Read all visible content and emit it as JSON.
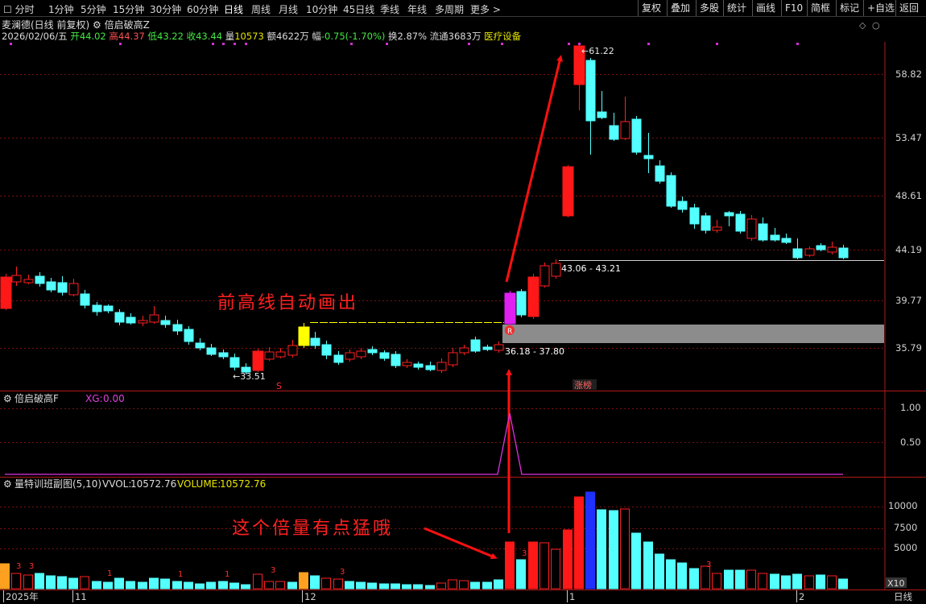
{
  "toolbar": {
    "periods": [
      "分时",
      "1分钟",
      "5分钟",
      "15分钟",
      "30分钟",
      "60分钟",
      "日线",
      "周线",
      "月线",
      "10分钟",
      "45日线",
      "季线",
      "年线",
      "多周期",
      "更多"
    ],
    "more_arrow": ">",
    "right_buttons": [
      "复权",
      "叠加",
      "多股",
      "统计",
      "画线",
      "F10",
      "简框",
      "标记",
      "+自选",
      "返回"
    ]
  },
  "stock": {
    "name": "麦澜德(日线 前复权)",
    "indicator": "倍启破高Z",
    "date": "2026/02/06/五",
    "open_label": "开",
    "open": "44.02",
    "high_label": "高",
    "high": "44.37",
    "low_label": "低",
    "low": "43.22",
    "close_label": "收",
    "close": "43.44",
    "vol_label": "量",
    "vol": "10573",
    "amount_label": "额",
    "amount": "4622万",
    "change_label": "幅",
    "change": "-0.75(-1.70%)",
    "turnover_label": "换",
    "turnover": "2.87%",
    "float_label": "流通",
    "float_value": "3683万",
    "sector": "医疗设备"
  },
  "main_axis": {
    "ticks": [
      "58.82",
      "53.47",
      "48.61",
      "44.19",
      "39.77",
      "35.79"
    ]
  },
  "annotations": {
    "peak_label": "61.22",
    "low_label": "33.51",
    "zone1": "36.18 - 37.80",
    "zone2": "43.06 - 43.21",
    "text_prev_high": "前高线自动画出",
    "text_volume": "这个倍量有点猛哦",
    "zt_badge": "涨榜",
    "s_marker": "S",
    "r_marker": "R"
  },
  "sub1": {
    "title": "倍启破高F",
    "label": "XG:",
    "value": "0.00",
    "ticks": [
      "1.00",
      "0.50"
    ]
  },
  "sub2": {
    "title": "量特训班副图(5,10)",
    "vvol_label": "VVOL:",
    "vvol": "10572.76",
    "volume_label": "VOLUME:",
    "volume": "10572.76",
    "ticks": [
      "10000",
      "7500",
      "5000"
    ],
    "unit": "X10"
  },
  "bottom_axis": {
    "labels": [
      "2025年",
      "11",
      "12",
      "1",
      "2"
    ],
    "period": "日线"
  },
  "colors": {
    "up": "#ff2020",
    "down": "#54ffff",
    "grid": "#7a1010",
    "panel_border": "#b01818",
    "magenta": "#e030e0",
    "yellow": "#ffff00",
    "blue": "#2030ff"
  }
}
